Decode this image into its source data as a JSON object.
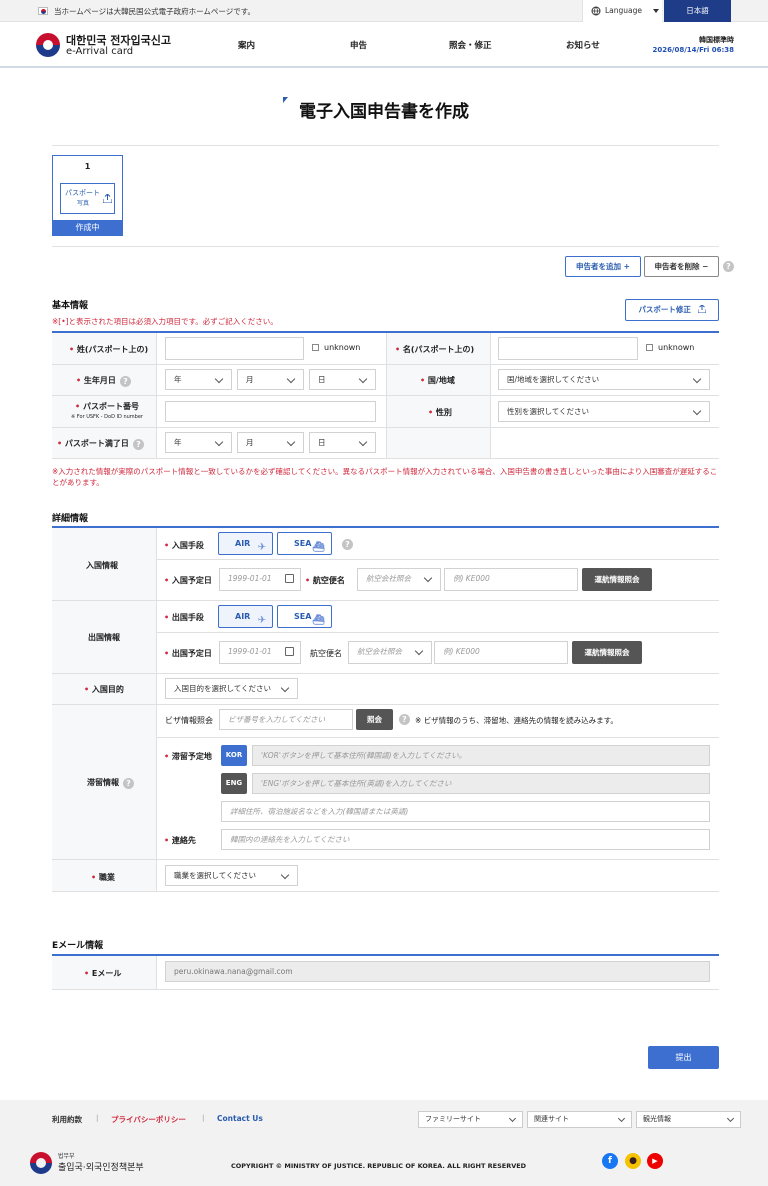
{
  "topbar": {
    "notice": "当ホームページは大韓民国公式電子政府ホームページです。",
    "language_label": "Language",
    "language_button": "日本語"
  },
  "header": {
    "logo_line1": "대한민국 전자입국신고",
    "logo_line2": "e-Arrival card",
    "nav": [
      "案内",
      "申告",
      "照会・修正",
      "お知らせ"
    ],
    "time_label": "韓国標準時",
    "time_value": "2026/08/14/Fri 06:38"
  },
  "page_title": "電子入国申告書を作成",
  "applicant_card": {
    "number": "1",
    "photo_label": "パスポート",
    "photo_sub": "写真",
    "status": "作成中"
  },
  "actions": {
    "add_applicant": "申告者を追加 +",
    "remove_applicant": "申告者を削除 −",
    "passport_edit": "パスポート修正"
  },
  "basic": {
    "title": "基本情報",
    "required_note": "※[•]と表示された項目は必須入力項目です。必ずご記入ください。",
    "surname_label": "姓(パスポート上の)",
    "given_label": "名(パスポート上の)",
    "unknown": "unknown",
    "birth_label": "生年月日",
    "year": "年",
    "month": "月",
    "day": "日",
    "country_label": "国/地域",
    "country_placeholder": "国/地域を選択してください",
    "passport_no_label": "パスポート番号",
    "passport_no_sub": "※ For USFK - DoD ID number",
    "gender_label": "性別",
    "gender_placeholder": "性別を選択してください",
    "expiry_label": "パスポート満了日",
    "warning": "※入力された情報が実際のパスポート情報と一致しているかを必ず確認してください。異なるパスポート情報が入力されている場合、入国申告書の書き直しといった事由により入国審査が遅延することがあります。"
  },
  "detail": {
    "title": "詳細情報",
    "entry_info": "入国情報",
    "entry_means": "入国手段",
    "air": "AIR",
    "sea": "SEA",
    "entry_date": "入国予定日",
    "date_placeholder": "1999-01-01",
    "flight_label": "航空便名",
    "airline_placeholder": "航空会社照会",
    "flight_placeholder": "例) KE000",
    "flight_lookup": "運航情報照会",
    "exit_info": "出国情報",
    "exit_means": "出国手段",
    "exit_date": "出国予定日",
    "purpose_label": "入国目的",
    "purpose_placeholder": "入国目的を選択してください",
    "stay_info": "滞留情報",
    "visa_lookup_label": "ビザ情報照会",
    "visa_placeholder": "ビザ番号を入力してください",
    "visa_button": "照会",
    "visa_note": "※ ビザ情報のうち、滞留地、連絡先の情報を読み込みます。",
    "stay_address_label": "滞留予定地",
    "kor_tag": "KOR",
    "eng_tag": "ENG",
    "kor_placeholder": "'KOR'ボタンを押して基本住所(韓国語)を入力してください。",
    "eng_placeholder": "'ENG'ボタンを押して基本住所(英語)を入力してください",
    "detail_addr_placeholder": "詳細住所、宿泊施設名などを入力(韓国語または英語)",
    "contact_label": "連絡先",
    "contact_placeholder": "韓国内の連絡先を入力してください",
    "job_label": "職業",
    "job_placeholder": "職業を選択してください"
  },
  "email": {
    "title": "Eメール情報",
    "label": "Eメール",
    "value": "peru.okinawa.nana@gmail.com"
  },
  "submit": "提出",
  "footer": {
    "terms": "利用約款",
    "privacy": "プライバシーポリシー",
    "contact": "Contact Us",
    "family_site": "ファミリーサイト",
    "related_site": "関連サイト",
    "tourism": "観光情報",
    "ministry_small": "법무부",
    "ministry": "출입국·외국인정책본부",
    "copyright": "COPYRIGHT © MINISTRY OF JUSTICE. REPUBLIC OF KOREA. ALL RIGHT RESERVED"
  },
  "colors": {
    "accent": "#3d6fd1",
    "navy": "#1f3c88",
    "required": "#d0283c"
  }
}
